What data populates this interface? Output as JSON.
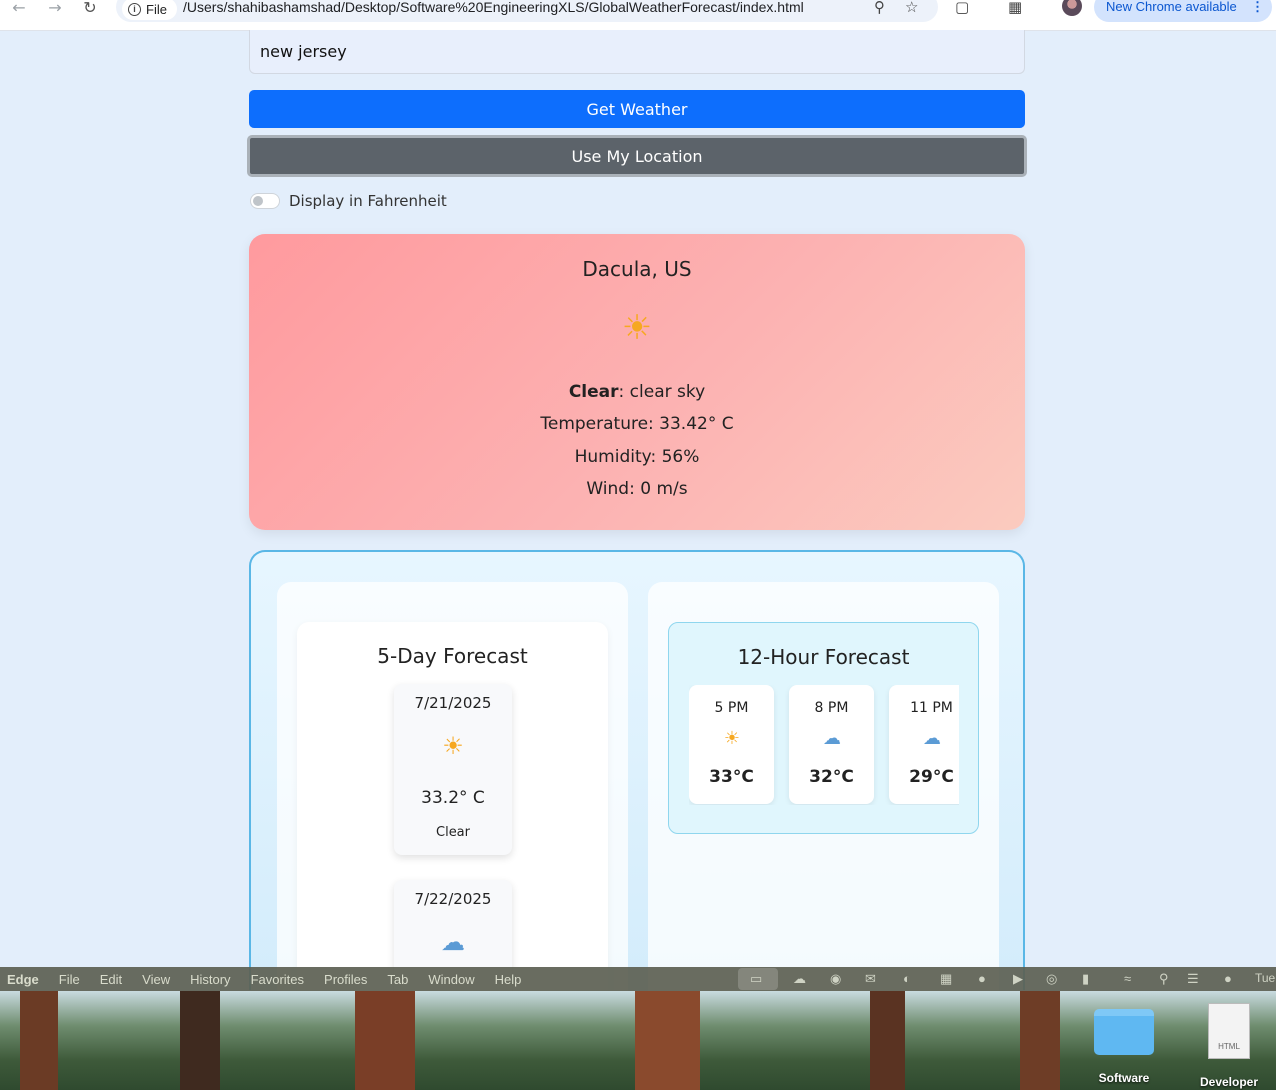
{
  "browser": {
    "file_label": "File",
    "url": "/Users/shahibashamshad/Desktop/Software%20EngineeringXLS/GlobalWeatherForecast/index.html",
    "update_pill": "New Chrome available"
  },
  "search": {
    "value": "new jersey"
  },
  "buttons": {
    "get_weather": "Get Weather",
    "use_location": "Use My Location"
  },
  "toggle": {
    "label": "Display in Fahrenheit",
    "on": false
  },
  "current": {
    "city": "Dacula, US",
    "icon": "sun-icon",
    "condition_main": "Clear",
    "condition_desc": ": clear sky",
    "temperature": "Temperature: 33.42° C",
    "humidity": "Humidity: 56%",
    "wind": "Wind: 0 m/s"
  },
  "daily": {
    "title": "5-Day Forecast",
    "days": [
      {
        "date": "7/21/2025",
        "icon": "sun-icon",
        "temp": "33.2° C",
        "desc": "Clear"
      },
      {
        "date": "7/22/2025",
        "icon": "cloud-icon"
      }
    ]
  },
  "hourly": {
    "title": "12-Hour Forecast",
    "hours": [
      {
        "time": "5 PM",
        "icon": "sun-icon",
        "temp": "33°C"
      },
      {
        "time": "8 PM",
        "icon": "cloud-icon",
        "temp": "32°C"
      },
      {
        "time": "11 PM",
        "icon": "cloud-icon",
        "temp": "29°C"
      }
    ]
  },
  "menubar": {
    "app": "Edge",
    "items": [
      "File",
      "Edit",
      "View",
      "History",
      "Favorites",
      "Profiles",
      "Tab",
      "Window",
      "Help"
    ],
    "clock": "Tue"
  },
  "desktop": {
    "icons": [
      {
        "label": "Software",
        "kind": "folder"
      },
      {
        "label": "Developer",
        "kind": "html-document",
        "badge": "HTML"
      }
    ]
  }
}
